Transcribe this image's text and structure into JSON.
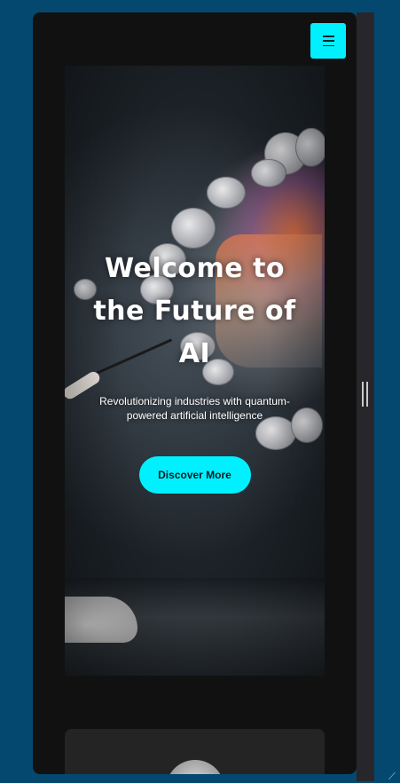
{
  "header": {
    "menu_icon": "hamburger-menu-icon"
  },
  "hero": {
    "title": "Welcome to the Future of AI",
    "subtitle": "Revolutionizing industries with quantum-powered artificial intelligence",
    "cta_label": "Discover More"
  },
  "colors": {
    "accent": "#00f0ff",
    "page_background": "#111111",
    "outer_background": "#044870",
    "card_background": "#242424"
  }
}
